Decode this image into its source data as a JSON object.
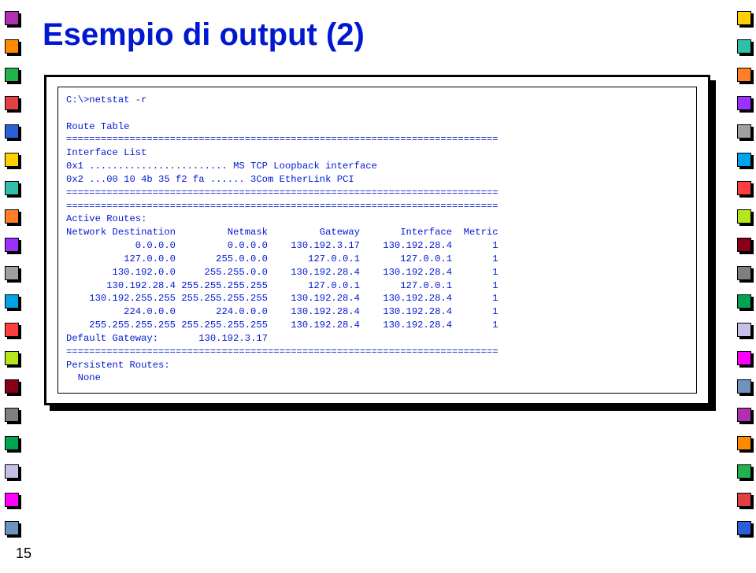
{
  "decor_colors": [
    "#b12fb1",
    "#ff8a00",
    "#22b14c",
    "#e04040",
    "#2b5fd8",
    "#ffcf00",
    "#30c0a7",
    "#ff7f27",
    "#9b30ff",
    "#a0a0a0",
    "#00a2e8",
    "#ff3f3f",
    "#b5e61d",
    "#880015",
    "#7f7f7f",
    "#00a254",
    "#c8bfe7",
    "#ff00ff",
    "#7092be"
  ],
  "title": "Esempio di output (2)",
  "page_number": "15",
  "terminal": {
    "command": "C:\\>netstat -r",
    "lines": [
      "",
      "Route Table",
      "===========================================================================",
      "Interface List",
      "0x1 ........................ MS TCP Loopback interface",
      "0x2 ...00 10 4b 35 f2 fa ...... 3Com EtherLink PCI",
      "===========================================================================",
      "===========================================================================",
      "Active Routes:"
    ],
    "route_header": [
      "Network Destination",
      "Netmask",
      "Gateway",
      "Interface",
      "Metric"
    ],
    "routes": [
      {
        "dest": "0.0.0.0",
        "mask": "0.0.0.0",
        "gw": "130.192.3.17",
        "iface": "130.192.28.4",
        "metric": "1"
      },
      {
        "dest": "127.0.0.0",
        "mask": "255.0.0.0",
        "gw": "127.0.0.1",
        "iface": "127.0.0.1",
        "metric": "1"
      },
      {
        "dest": "130.192.0.0",
        "mask": "255.255.0.0",
        "gw": "130.192.28.4",
        "iface": "130.192.28.4",
        "metric": "1"
      },
      {
        "dest": "130.192.28.4",
        "mask": "255.255.255.255",
        "gw": "127.0.0.1",
        "iface": "127.0.0.1",
        "metric": "1"
      },
      {
        "dest": "130.192.255.255",
        "mask": "255.255.255.255",
        "gw": "130.192.28.4",
        "iface": "130.192.28.4",
        "metric": "1"
      },
      {
        "dest": "224.0.0.0",
        "mask": "224.0.0.0",
        "gw": "130.192.28.4",
        "iface": "130.192.28.4",
        "metric": "1"
      },
      {
        "dest": "255.255.255.255",
        "mask": "255.255.255.255",
        "gw": "130.192.28.4",
        "iface": "130.192.28.4",
        "metric": "1"
      }
    ],
    "default_gateway_label": "Default Gateway:",
    "default_gateway": "130.192.3.17",
    "tail_lines": [
      "===========================================================================",
      "Persistent Routes:",
      "  None"
    ]
  }
}
